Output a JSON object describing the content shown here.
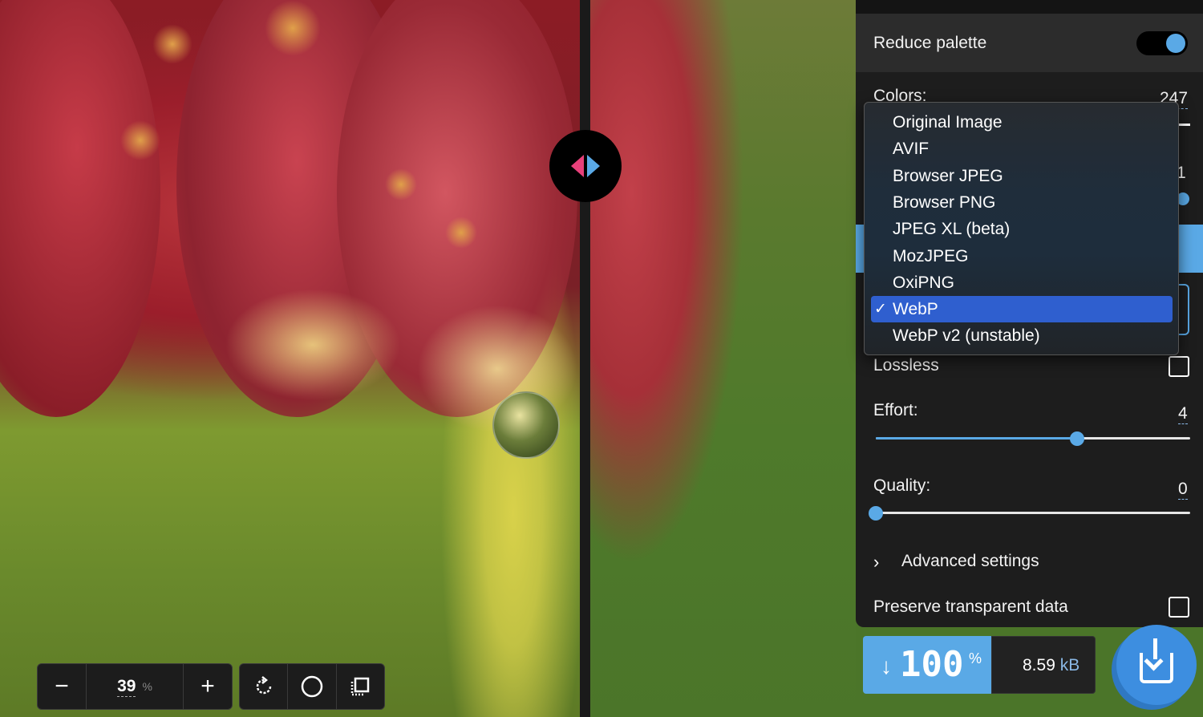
{
  "comparison": {
    "divider_left_color": "#e8407a",
    "divider_right_color": "#5aa9e6"
  },
  "zoom": {
    "minus_icon": "minus-icon",
    "value": "39",
    "unit": "%",
    "plus_icon": "plus-icon"
  },
  "tools": {
    "rotate_icon": "rotate-icon",
    "background_icon": "circle-icon",
    "crop_icon": "crop-icon"
  },
  "settings": {
    "reduce_palette_label": "Reduce palette",
    "reduce_palette_on": true,
    "colors_label": "Colors:",
    "colors_value": "247",
    "lossless_label": "Lossless",
    "lossless_checked": false,
    "effort_label": "Effort:",
    "effort_value": "4",
    "effort_level": 0.64,
    "quality_label": "Quality:",
    "quality_value": "0",
    "quality_level": 0.0,
    "advanced_label": "Advanced settings",
    "preserve_label": "Preserve transparent data",
    "preserve_checked": false
  },
  "dropdown": {
    "options": [
      "Original Image",
      "AVIF",
      "Browser JPEG",
      "Browser PNG",
      "JPEG XL (beta)",
      "MozJPEG",
      "OxiPNG",
      "WebP",
      "WebP v2 (unstable)"
    ],
    "selected": "WebP",
    "check_mark": "✓"
  },
  "result": {
    "arrow": "↓",
    "percent": "100",
    "percent_sign": "%",
    "size": "8.59",
    "size_unit": "kB"
  },
  "download": {
    "icon": "download-icon"
  },
  "colors": {
    "accent": "#5aa9e6",
    "panel": "#1d1d1d",
    "selected": "#2f5fcf"
  }
}
